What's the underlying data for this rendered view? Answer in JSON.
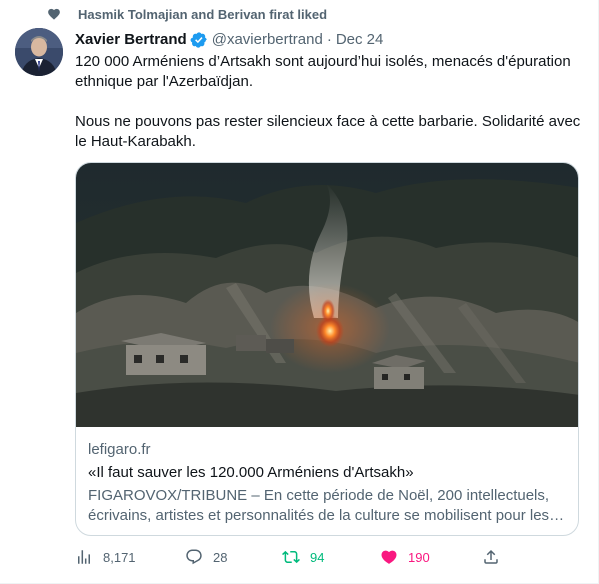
{
  "social_context": {
    "text": "Hasmik Tolmajian and Berivan firat liked",
    "icon": "heart-icon"
  },
  "author": {
    "name": "Xavier Bertrand",
    "handle": "@xavierbertrand",
    "separator": "·",
    "date": "Dec 24",
    "verified_icon": "verified-badge-icon",
    "avatar_icon": "avatar"
  },
  "tweet": {
    "paragraph_1": "120 000 Arméniens d’Artsakh sont aujourd’hui isolés, menacés d'épuration ethnique par l'Azerbaïdjan.",
    "paragraph_2": "Nous ne pouvons pas rester silencieux face à cette barbarie. Solidarité avec le Haut-Karabakh."
  },
  "card": {
    "domain": "lefigaro.fr",
    "title": "«Il faut sauver les 120.000 Arméniens d'Artsakh»",
    "description_line_1": "FIGAROVOX/TRIBUNE – En cette période de Noël, 200 intellectuels,",
    "description_line_2": "écrivains, artistes et personnalités de la culture se mobilisent pour les …",
    "image_icon": "burning-village-image"
  },
  "actions": {
    "views": {
      "count": "8,171",
      "icon": "views-icon"
    },
    "reply": {
      "count": "28",
      "icon": "reply-icon"
    },
    "retweet": {
      "count": "94",
      "icon": "retweet-icon",
      "color": "#00ba7c"
    },
    "like": {
      "count": "190",
      "icon": "heart-filled-icon",
      "color": "#f91880"
    },
    "share": {
      "icon": "share-icon"
    }
  },
  "colors": {
    "secondary_text": "#536471",
    "primary_text": "#0f1419",
    "verified_blue": "#1d9bf0",
    "border": "#cfd9de"
  }
}
